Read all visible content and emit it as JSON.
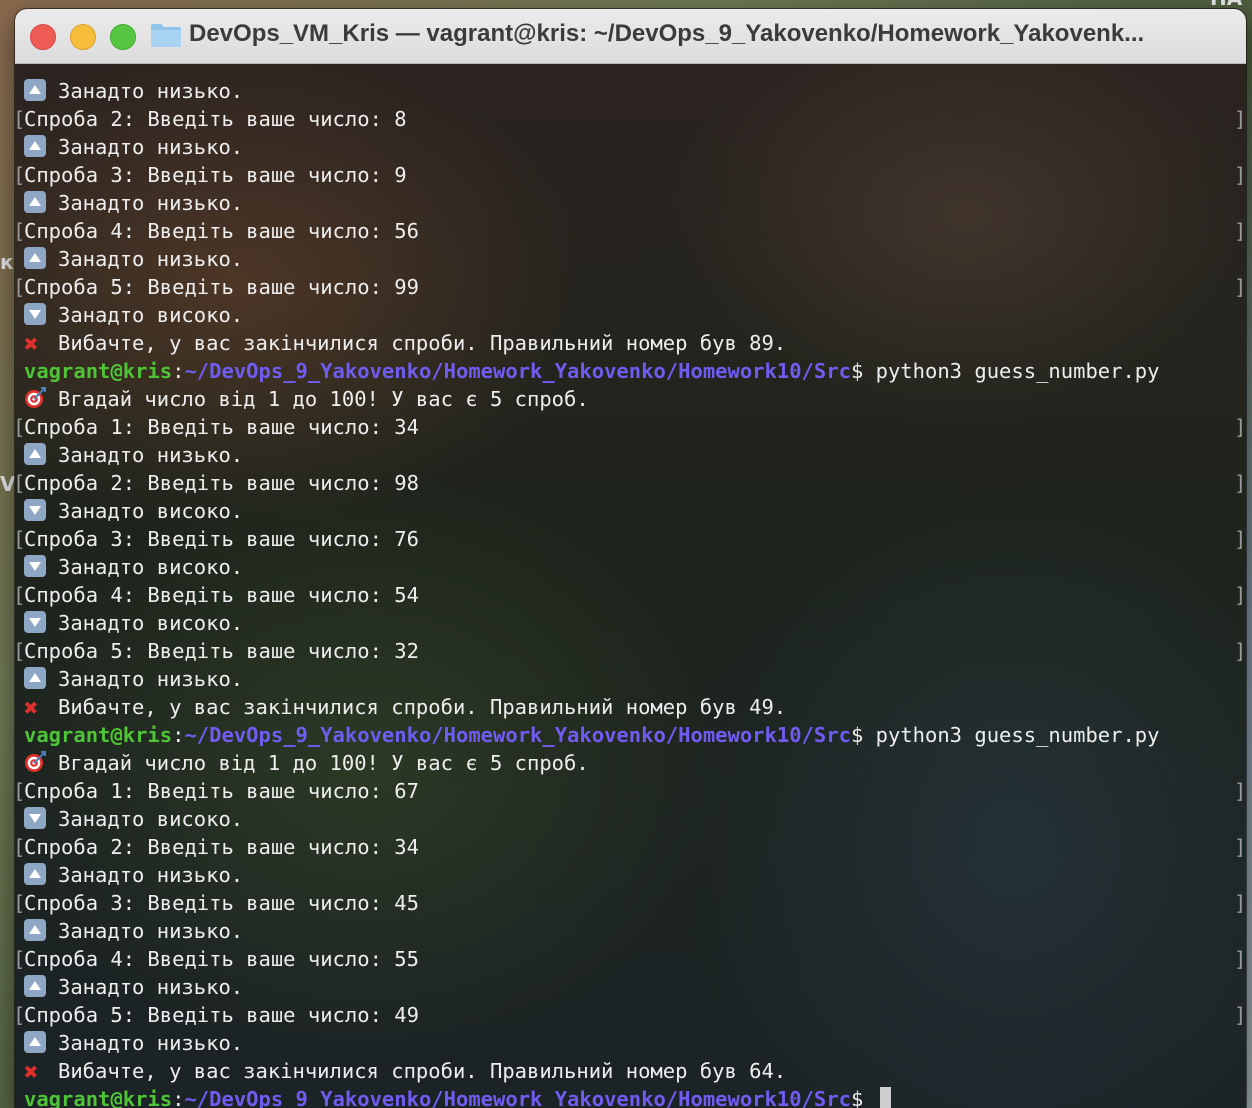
{
  "window": {
    "title": "DevOps_VM_Kris — vagrant@kris: ~/DevOps_9_Yakovenko/Homework_Yakovenk..."
  },
  "desktop": {
    "left_edge_1": "к",
    "left_edge_2": "VI",
    "top_right": "ПА"
  },
  "prompt": {
    "user": "vagrant@kris",
    "sep": ":",
    "path": "~/DevOps_9_Yakovenko/Homework_Yakovenko/Homework10/Src",
    "dollar": "$ ",
    "command": "python3 guess_number.py"
  },
  "lines": [
    {
      "type": "up",
      "text": "Занадто низько."
    },
    {
      "type": "input",
      "text": "Спроба 2: Введіть ваше число: 8"
    },
    {
      "type": "up",
      "text": "Занадто низько."
    },
    {
      "type": "input",
      "text": "Спроба 3: Введіть ваше число: 9"
    },
    {
      "type": "up",
      "text": "Занадто низько."
    },
    {
      "type": "input",
      "text": "Спроба 4: Введіть ваше число: 56"
    },
    {
      "type": "up",
      "text": "Занадто низько."
    },
    {
      "type": "input",
      "text": "Спроба 5: Введіть ваше число: 99"
    },
    {
      "type": "down",
      "text": "Занадто високо."
    },
    {
      "type": "fail",
      "text": "Вибачте, у вас закінчилися спроби. Правильний номер був 89."
    },
    {
      "type": "prompt"
    },
    {
      "type": "start",
      "text": "Вгадай число від 1 до 100! У вас є 5 спроб."
    },
    {
      "type": "input",
      "text": "Спроба 1: Введіть ваше число: 34"
    },
    {
      "type": "up",
      "text": "Занадто низько."
    },
    {
      "type": "input",
      "text": "Спроба 2: Введіть ваше число: 98"
    },
    {
      "type": "down",
      "text": "Занадто високо."
    },
    {
      "type": "input",
      "text": "Спроба 3: Введіть ваше число: 76"
    },
    {
      "type": "down",
      "text": "Занадто високо."
    },
    {
      "type": "input",
      "text": "Спроба 4: Введіть ваше число: 54"
    },
    {
      "type": "down",
      "text": "Занадто високо."
    },
    {
      "type": "input",
      "text": "Спроба 5: Введіть ваше число: 32"
    },
    {
      "type": "up",
      "text": "Занадто низько."
    },
    {
      "type": "fail",
      "text": "Вибачте, у вас закінчилися спроби. Правильний номер був 49."
    },
    {
      "type": "prompt"
    },
    {
      "type": "start",
      "text": "Вгадай число від 1 до 100! У вас є 5 спроб."
    },
    {
      "type": "input",
      "text": "Спроба 1: Введіть ваше число: 67"
    },
    {
      "type": "down",
      "text": "Занадто високо."
    },
    {
      "type": "input",
      "text": "Спроба 2: Введіть ваше число: 34"
    },
    {
      "type": "up",
      "text": "Занадто низько."
    },
    {
      "type": "input",
      "text": "Спроба 3: Введіть ваше число: 45"
    },
    {
      "type": "up",
      "text": "Занадто низько."
    },
    {
      "type": "input",
      "text": "Спроба 4: Введіть ваше число: 55"
    },
    {
      "type": "up",
      "text": "Занадто низько."
    },
    {
      "type": "input",
      "text": "Спроба 5: Введіть ваше число: 49"
    },
    {
      "type": "up",
      "text": "Занадто низько."
    },
    {
      "type": "fail",
      "text": "Вибачте, у вас закінчилися спроби. Правильний номер був 64."
    },
    {
      "type": "final_prompt"
    }
  ],
  "icons": {
    "up": "arrow-up-button-icon",
    "down": "arrow-down-button-icon",
    "fail": "cross-mark-icon",
    "start": "direct-hit-target-icon",
    "folder": "folder-icon"
  }
}
